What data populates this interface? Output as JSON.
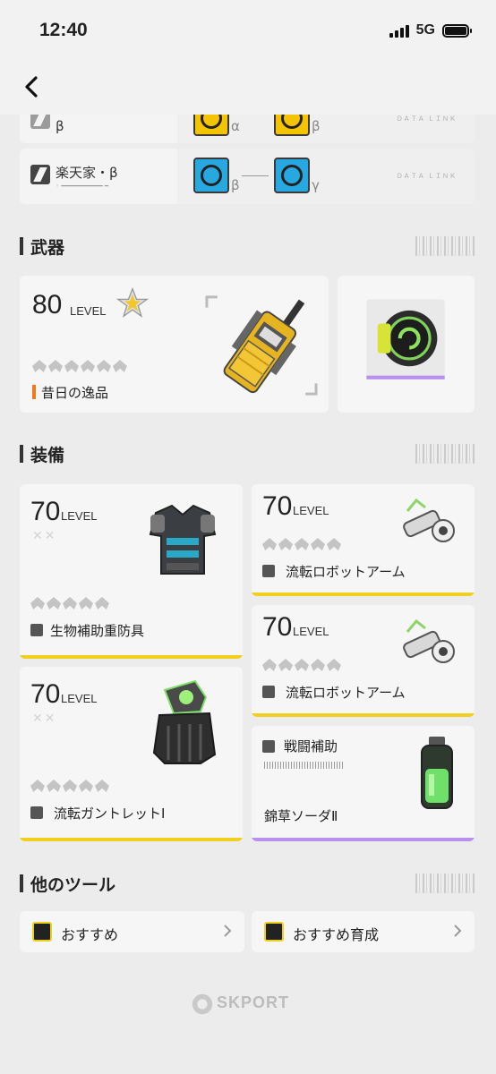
{
  "status_bar": {
    "time": "12:40",
    "network": "5G"
  },
  "operator_rows": [
    {
      "name": "β",
      "skills": [
        {
          "color": "yellow",
          "greek": "α"
        },
        {
          "color": "yellow",
          "greek": "β"
        }
      ]
    },
    {
      "name": "楽天家・β",
      "skills": [
        {
          "color": "blue",
          "greek": "β"
        },
        {
          "color": "blue",
          "greek": "γ"
        }
      ]
    }
  ],
  "weapon_section": {
    "title": "武器",
    "weapon": {
      "level": "80",
      "level_label": "LEVEL",
      "name": "昔日の逸品"
    }
  },
  "equipment_section": {
    "title": "装備",
    "items": [
      {
        "level": "70",
        "level_label": "LEVEL",
        "name": "生物補助重防具"
      },
      {
        "level": "70",
        "level_label": "LEVEL",
        "name": "流転ロボットアーム"
      },
      {
        "level": "70",
        "level_label": "LEVEL",
        "name": "流転ロボットアーム"
      },
      {
        "level": "70",
        "level_label": "LEVEL",
        "name": "流転ガントレットⅠ"
      },
      {
        "category": "戦闘補助",
        "name": "錦草ソーダⅡ"
      }
    ]
  },
  "tools_section": {
    "title": "他のツール",
    "buttons": [
      {
        "label": "おすすめ"
      },
      {
        "label": "おすすめ育成"
      }
    ]
  },
  "footer": {
    "logo": "SKPORT"
  },
  "colors": {
    "accent_yellow": "#f1cf1f",
    "accent_purple": "#b890f0",
    "accent_orange": "#f07a1c"
  }
}
